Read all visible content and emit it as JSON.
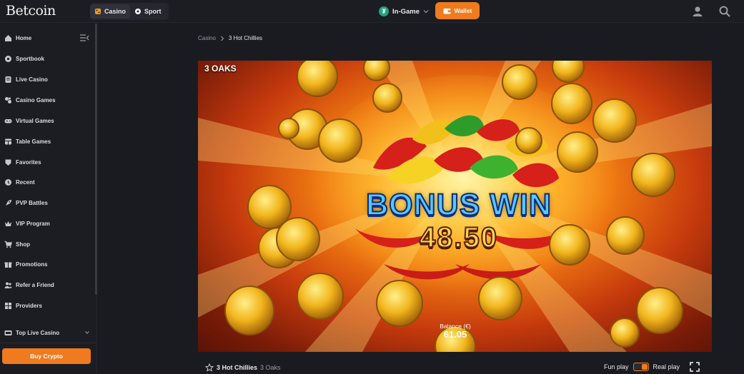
{
  "header": {
    "logo_text": "Betcoin",
    "nav": [
      {
        "label": "Casino",
        "icon": "casino-icon",
        "active": true
      },
      {
        "label": "Sport",
        "icon": "sport-icon",
        "active": false
      }
    ],
    "currency_label": "In-Game",
    "currency_icon": "tether-icon",
    "wallet_label": "Wallet",
    "accent": "#f07b1d"
  },
  "sidebar": {
    "items": [
      {
        "label": "Home",
        "icon": "home-icon"
      },
      {
        "label": "Sportbook",
        "icon": "ball-icon"
      },
      {
        "label": "Live Casino",
        "icon": "live-icon"
      },
      {
        "label": "Casino Games",
        "icon": "dice-icon"
      },
      {
        "label": "Virtual Games",
        "icon": "gamepad-icon"
      },
      {
        "label": "Table Games",
        "icon": "table-icon"
      },
      {
        "label": "Favorites",
        "icon": "heart-icon"
      },
      {
        "label": "Recent",
        "icon": "clock-icon"
      },
      {
        "label": "PVP Battles",
        "icon": "rocket-icon"
      },
      {
        "label": "VIP Program",
        "icon": "crown-icon"
      },
      {
        "label": "Shop",
        "icon": "cart-icon"
      },
      {
        "label": "Promotions",
        "icon": "gift-icon"
      },
      {
        "label": "Refer a Friend",
        "icon": "users-icon"
      },
      {
        "label": "Providers",
        "icon": "grid-icon"
      }
    ],
    "top_live_casino": "Top Live Casino",
    "buy_crypto": "Buy Crypto"
  },
  "breadcrumb": {
    "parent": "Casino",
    "current": "3 Hot Chillies"
  },
  "game": {
    "provider_logo": "3 OAKS",
    "banner_title": "BONUS WIN",
    "banner_amount": "48.50",
    "balance_label": "Balance (€)",
    "balance_value": "61.05"
  },
  "game_footer": {
    "name": "3 Hot Chillies",
    "provider": "3 Oaks",
    "fun_play": "Fun play",
    "real_play": "Real play",
    "real_play_selected": true
  }
}
